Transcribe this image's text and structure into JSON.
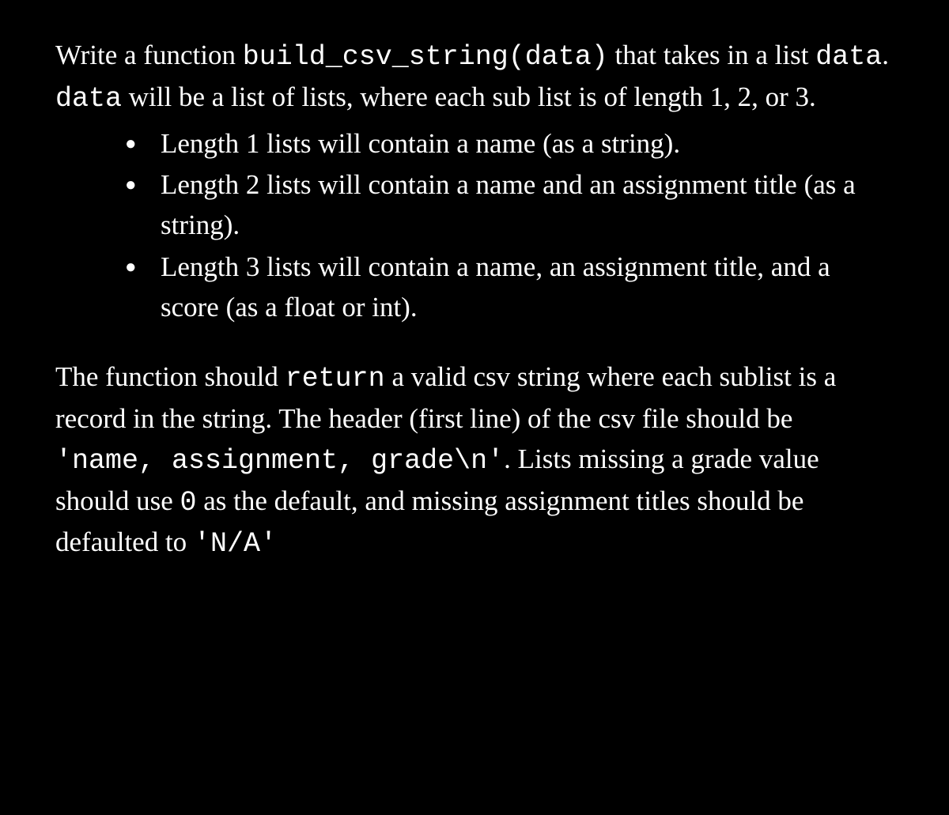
{
  "intro": {
    "t1": "Write a function ",
    "code1": "build_csv_string(data)",
    "t2": " that takes in a list ",
    "code2": "data",
    "t3": ". ",
    "code3": "data",
    "t4": " will be a list of lists, where each sub list is of length 1, 2, or 3."
  },
  "bullets": [
    "Length 1 lists will contain a name (as a string).",
    "Length 2 lists will contain a name and an assignment title (as a string).",
    "Length 3 lists will contain a name, an assignment title, and a score (as a float or int)."
  ],
  "body": {
    "t1": "The function should ",
    "code1": "return",
    "t2": " a valid csv string where each sublist is a record in the string. The header (first line) of the csv file should be ",
    "code2": "'name, assignment, grade\\n'",
    "t3": ". Lists missing a grade value should use ",
    "code3": "0",
    "t4": " as the default, and missing assignment titles should be defaulted to ",
    "code4": "'N/A'"
  }
}
